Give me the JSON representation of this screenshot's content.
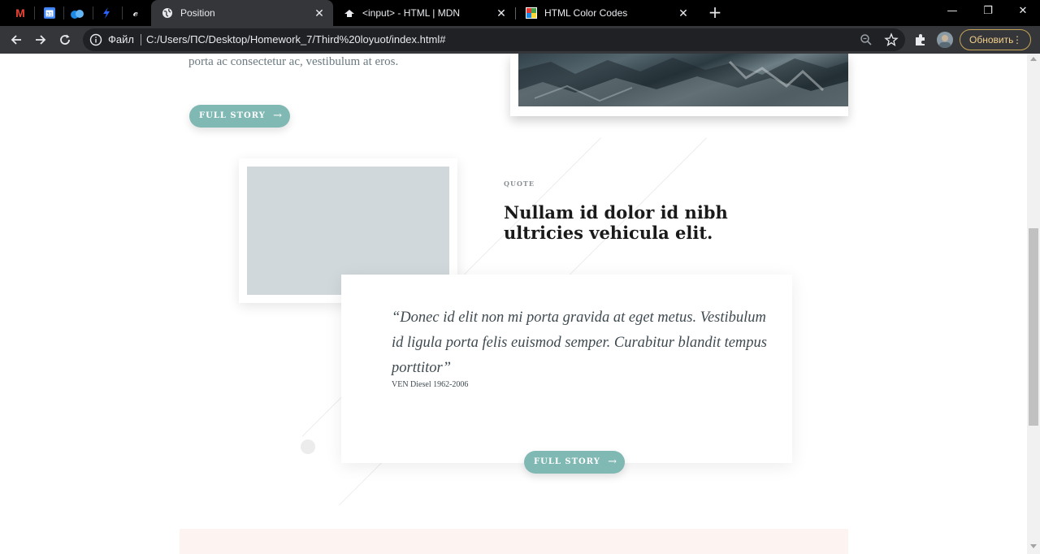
{
  "browser": {
    "tabs": [
      {
        "title": "Position",
        "active": true,
        "favicon": "globe-icon"
      },
      {
        "title": "<input> - HTML | MDN",
        "active": false,
        "favicon": "mdn-icon"
      },
      {
        "title": "HTML Color Codes",
        "active": false,
        "favicon": "color-codes-icon"
      }
    ],
    "pinned_tabs": [
      "gmail-icon",
      "calendar-icon",
      "app-icon",
      "bolt-icon",
      "script-icon"
    ],
    "omnibox": {
      "security_label": "Файл",
      "url": "C:/Users/ПС/Desktop/Homework_7/Third%20loyuot/index.html#"
    },
    "update_button": "Обновить",
    "accent_color": "#f2d08a"
  },
  "page": {
    "story_tail": "porta ac consectetur ac, vestibulum at eros.",
    "full_story_label": "FULL STORY",
    "arrow_glyph": "→",
    "quote_section": {
      "eyebrow": "QUOTE",
      "headline": "Nullam id dolor id nibh ultricies vehicula elit.",
      "quote": "“Donec id elit non mi porta gravida at eget metus. Vestibulum id ligula porta felis euismod semper. Curabitur blandit tempus porttitor”",
      "author": "VEN Diesel 1962-2006",
      "button_label": "FULL STORY"
    },
    "button_color": "#80b8b3"
  }
}
